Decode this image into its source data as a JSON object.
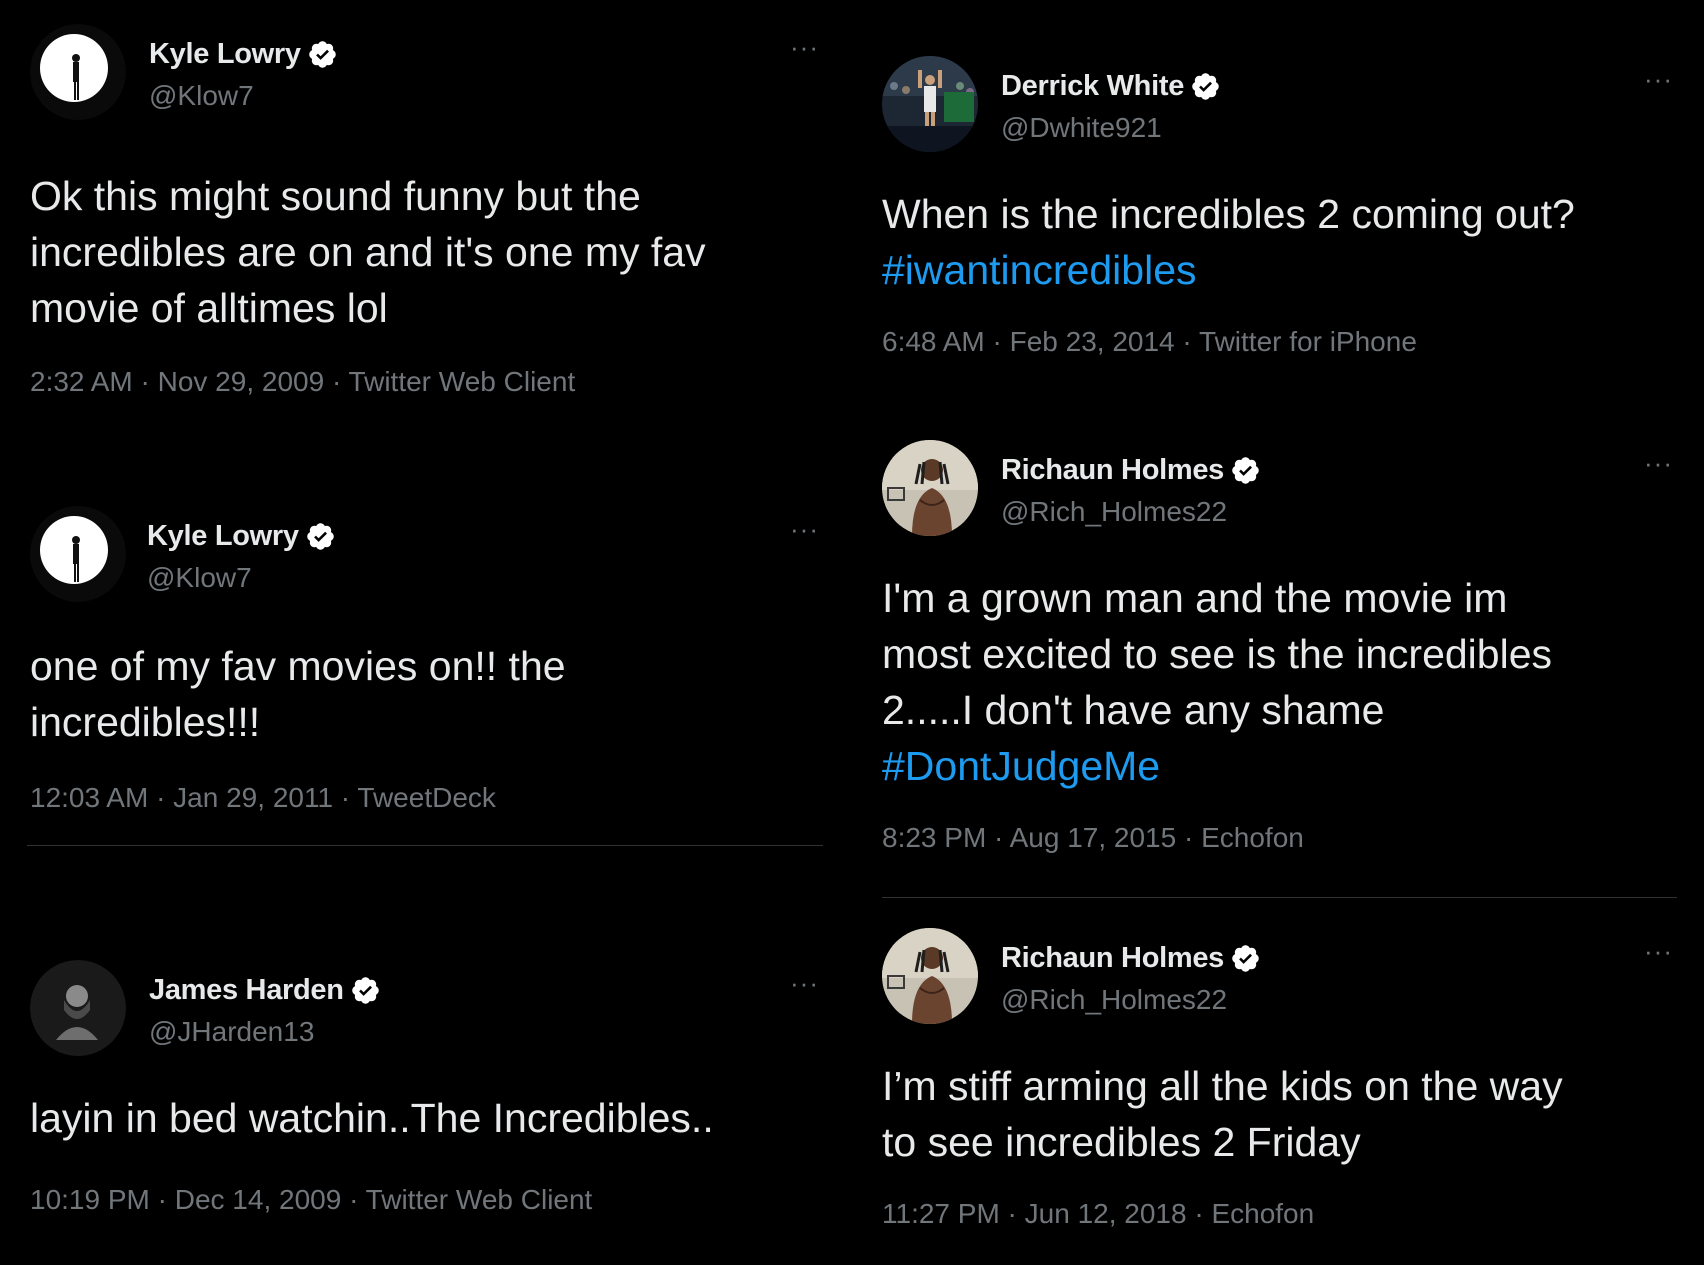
{
  "tweets": {
    "t1": {
      "name": "Kyle Lowry",
      "handle": "@Klow7",
      "more": "···",
      "lines": [
        "Ok this might sound funny but the",
        "incredibles are on and it's one my fav",
        "movie of alltimes lol"
      ],
      "meta": "2:32 AM · Nov 29, 2009 · Twitter Web Client"
    },
    "t2": {
      "name": "Kyle Lowry",
      "handle": "@Klow7",
      "more": "···",
      "lines": [
        "one of my fav movies on!! the",
        "incredibles!!!"
      ],
      "meta": "12:03 AM · Jan 29, 2011 · TweetDeck"
    },
    "t3": {
      "name": "James Harden",
      "handle": "@JHarden13",
      "more": "···",
      "lines": [
        "layin in bed watchin..The Incredibles.."
      ],
      "meta": "10:19 PM · Dec 14, 2009 · Twitter Web Client"
    },
    "t4": {
      "name": "Derrick White",
      "handle": "@Dwhite921",
      "more": "···",
      "lines": [
        "When is the incredibles 2 coming out?"
      ],
      "hashtag": "#iwantincredibles",
      "meta": "6:48 AM · Feb 23, 2014 · Twitter for iPhone"
    },
    "t5": {
      "name": "Richaun Holmes",
      "handle": "@Rich_Holmes22",
      "more": "···",
      "lines": [
        "I'm a grown man and the movie im",
        "most excited to see is the incredibles",
        "2.....I don't have any shame"
      ],
      "hashtag": "#DontJudgeMe",
      "meta": "8:23 PM · Aug 17, 2015 · Echofon"
    },
    "t6": {
      "name": "Richaun Holmes",
      "handle": "@Rich_Holmes22",
      "more": "···",
      "lines": [
        "I’m stiff arming all the kids on the way",
        "to see incredibles 2 Friday"
      ],
      "meta": "11:27 PM · Jun 12, 2018 · Echofon"
    }
  },
  "icons": {
    "verified": "verified-badge-icon",
    "more": "more-options-icon"
  },
  "colors": {
    "background": "#000000",
    "text": "#e7e9ea",
    "muted": "#71767b",
    "hashtag": "#1d9bf0",
    "divider": "#2f3336"
  }
}
